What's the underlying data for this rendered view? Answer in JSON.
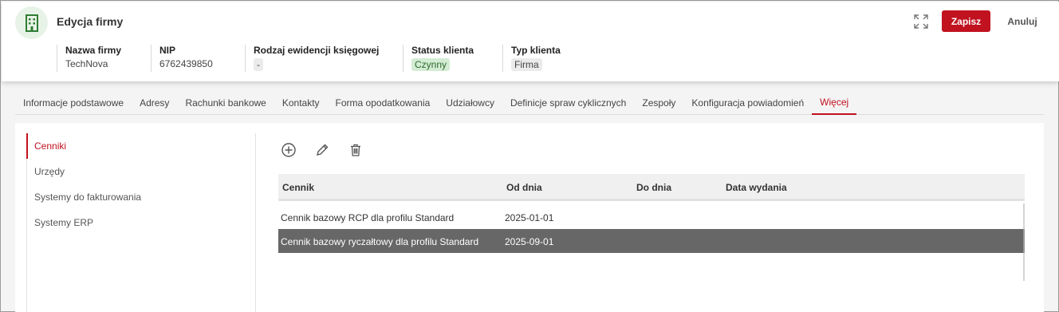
{
  "header": {
    "title": "Edycja firmy",
    "save_label": "Zapisz",
    "cancel_label": "Anuluj",
    "fields": [
      {
        "label": "Nazwa firmy",
        "value": "TechNova"
      },
      {
        "label": "NIP",
        "value": "6762439850"
      },
      {
        "label": "Rodzaj ewidencji księgowej",
        "value": "-"
      },
      {
        "label": "Status klienta",
        "value": "Czynny"
      },
      {
        "label": "Typ klienta",
        "value": "Firma"
      }
    ]
  },
  "tabs": [
    {
      "label": "Informacje podstawowe"
    },
    {
      "label": "Adresy"
    },
    {
      "label": "Rachunki bankowe"
    },
    {
      "label": "Kontakty"
    },
    {
      "label": "Forma opodatkowania"
    },
    {
      "label": "Udziałowcy"
    },
    {
      "label": "Definicje spraw cyklicznych"
    },
    {
      "label": "Zespoły"
    },
    {
      "label": "Konfiguracja powiadomień"
    },
    {
      "label": "Więcej",
      "active": true
    }
  ],
  "side_nav": [
    {
      "label": "Cenniki",
      "active": true
    },
    {
      "label": "Urzędy"
    },
    {
      "label": "Systemy do fakturowania"
    },
    {
      "label": "Systemy ERP"
    }
  ],
  "toolbar": {
    "icons": [
      "add-circle-icon",
      "pencil-icon",
      "trash-icon"
    ]
  },
  "grid": {
    "columns": [
      "Cennik",
      "Od dnia",
      "Do dnia",
      "Data wydania"
    ],
    "rows": [
      {
        "cennik": "Cennik bazowy RCP dla profilu Standard",
        "od_dnia": "2025-01-01",
        "do_dnia": "",
        "data_wydania": ""
      },
      {
        "cennik": "Cennik bazowy ryczałtowy dla profilu Standard",
        "od_dnia": "2025-09-01",
        "do_dnia": "",
        "data_wydania": "",
        "selected": true
      }
    ]
  },
  "colors": {
    "accent": "#c1121f",
    "selected_row": "#676767",
    "status_green_bg": "#d3ecd3"
  }
}
